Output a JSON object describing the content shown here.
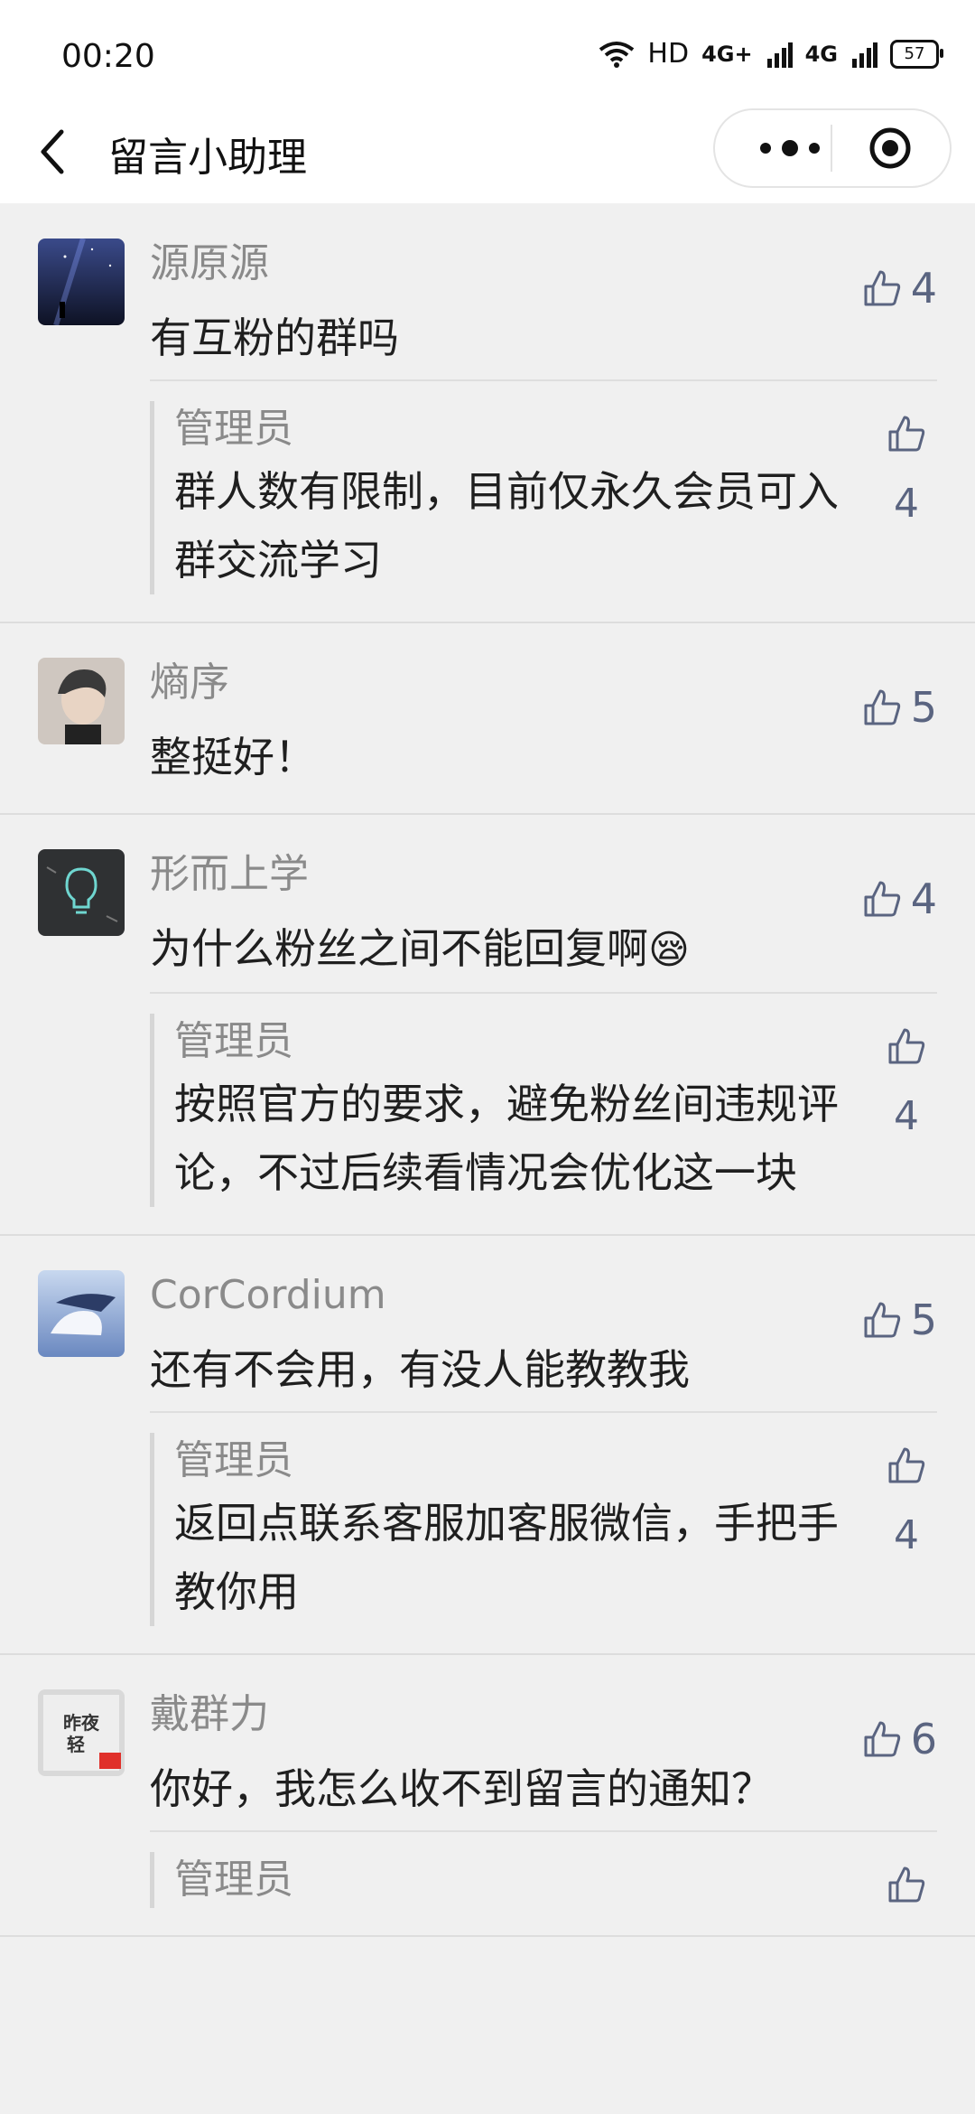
{
  "status": {
    "time": "00:20",
    "network": "HD",
    "sig1": "4G+",
    "sig2": "4G",
    "battery": "57"
  },
  "nav": {
    "title": "留言小助理",
    "back_icon": "back-arrow-icon",
    "more_icon": "more-dots-icon",
    "close_icon": "target-circle-icon"
  },
  "comments": [
    {
      "name": "源原源",
      "text": "有互粉的群吗",
      "likes": "4",
      "reply": {
        "name": "管理员",
        "text": "群人数有限制，目前仅永久会员可入群交流学习",
        "likes": "4"
      }
    },
    {
      "name": "熵序",
      "text": "整挺好！",
      "likes": "5"
    },
    {
      "name": "形而上学",
      "text": "为什么粉丝之间不能回复啊",
      "emoji": "😪",
      "likes": "4",
      "reply": {
        "name": "管理员",
        "text": "按照官方的要求，避免粉丝间违规评论，不过后续看情况会优化这一块",
        "likes": "4"
      }
    },
    {
      "name": "CorCordium",
      "text": "还有不会用，有没人能教教我",
      "likes": "5",
      "reply": {
        "name": "管理员",
        "text": "返回点联系客服加客服微信，手把手教你用",
        "likes": "4"
      }
    },
    {
      "name": "戴群力",
      "text": "你好，我怎么收不到留言的通知？",
      "likes": "6",
      "avatar_text": "昨夜轻",
      "reply": {
        "name": "管理员",
        "text": "",
        "likes": ""
      }
    }
  ],
  "colors": {
    "background": "#f0f0f0",
    "like": "#5a6480",
    "name": "#8a8a8a"
  }
}
